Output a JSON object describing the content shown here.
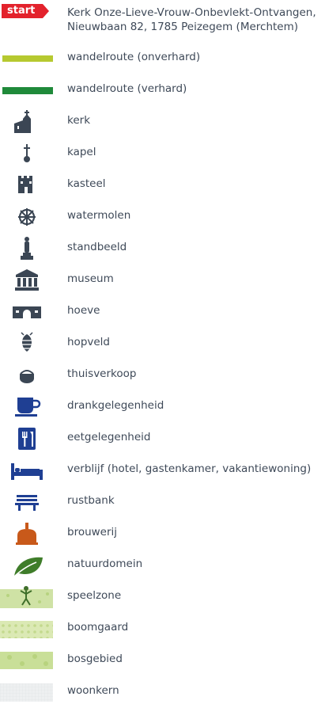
{
  "legend": {
    "start": {
      "badge": "start",
      "address_line1": "Kerk Onze-Lieve-Vrouw-Onbevlekt-Ontvangen,",
      "address_line2": "Nieuwbaan 82, 1785 Peizegem (Merchtem)"
    },
    "items": [
      {
        "icon": "route-unpaved-line",
        "label": "wandelroute (onverhard)",
        "color": "#b6c930"
      },
      {
        "icon": "route-paved-line",
        "label": "wandelroute (verhard)",
        "color": "#1f8a3a"
      },
      {
        "icon": "church-icon",
        "label": "kerk"
      },
      {
        "icon": "chapel-icon",
        "label": "kapel"
      },
      {
        "icon": "castle-icon",
        "label": "kasteel"
      },
      {
        "icon": "watermill-icon",
        "label": "watermolen"
      },
      {
        "icon": "statue-icon",
        "label": "standbeeld"
      },
      {
        "icon": "museum-icon",
        "label": "museum"
      },
      {
        "icon": "farm-icon",
        "label": "hoeve"
      },
      {
        "icon": "hop-field-icon",
        "label": "hopveld"
      },
      {
        "icon": "farm-shop-icon",
        "label": "thuisverkoop"
      },
      {
        "icon": "cafe-icon",
        "label": "drankgelegenheid",
        "color": "#1f3f93"
      },
      {
        "icon": "restaurant-icon",
        "label": "eetgelegenheid",
        "color": "#1f3f93"
      },
      {
        "icon": "lodging-icon",
        "label": "verblijf (hotel, gastenkamer, vakantiewoning)",
        "color": "#1f3f93"
      },
      {
        "icon": "bench-icon",
        "label": "rustbank",
        "color": "#1f3f93"
      },
      {
        "icon": "brewery-icon",
        "label": "brouwerij",
        "color": "#c8591a"
      },
      {
        "icon": "nature-leaf-icon",
        "label": "natuurdomein",
        "color": "#3f7d2a"
      },
      {
        "icon": "playzone-swatch",
        "label": "speelzone",
        "color": "#cfe2a5"
      },
      {
        "icon": "orchard-swatch",
        "label": "boomgaard",
        "color": "#dbe9b4"
      },
      {
        "icon": "forest-swatch",
        "label": "bosgebied",
        "color": "#c9df98"
      },
      {
        "icon": "residential-swatch",
        "label": "woonkern",
        "color": "#eef0f1"
      }
    ]
  }
}
